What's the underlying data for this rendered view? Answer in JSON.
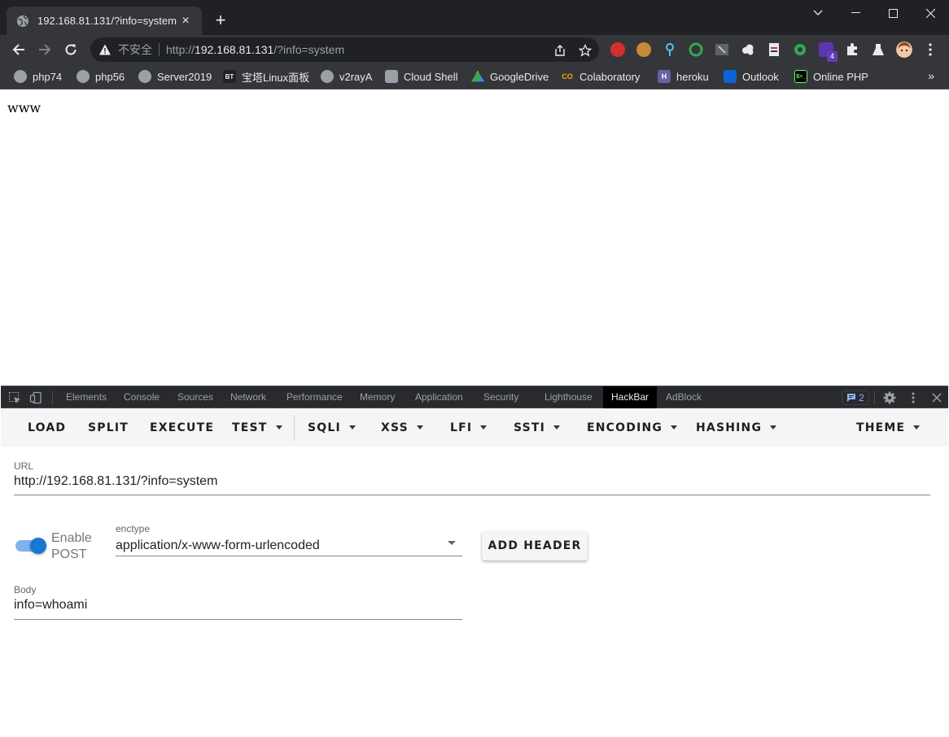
{
  "browser": {
    "tab_title": "192.168.81.131/?info=system",
    "tab_close": "×",
    "new_tab": "+",
    "security_label": "不安全",
    "url_scheme": "http://",
    "url_host": "192.168.81.131",
    "url_path": "/?info=system"
  },
  "bookmarks": [
    {
      "label": "php74",
      "icon": "globe-icon"
    },
    {
      "label": "php56",
      "icon": "globe-icon"
    },
    {
      "label": "Server2019",
      "icon": "globe-icon"
    },
    {
      "label": "宝塔Linux面板",
      "icon": "bt-icon",
      "icon_text": "BT"
    },
    {
      "label": "v2rayA",
      "icon": "globe-icon"
    },
    {
      "label": "Cloud Shell",
      "icon": "terminal-icon"
    },
    {
      "label": "GoogleDrive",
      "icon": "drive-icon"
    },
    {
      "label": "Colaboratory",
      "icon": "colab-icon",
      "icon_text": "CO"
    },
    {
      "label": "heroku",
      "icon": "heroku-icon",
      "icon_text": "H"
    },
    {
      "label": "Outlook",
      "icon": "outlook-icon"
    },
    {
      "label": "Online PHP",
      "icon": "php-shell-icon",
      "icon_text": "$>_"
    }
  ],
  "bookmarks_more": "»",
  "page": {
    "output": "www"
  },
  "devtools": {
    "tabs": [
      "Elements",
      "Console",
      "Sources",
      "Network",
      "Performance",
      "Memory",
      "Application",
      "Security",
      "Lighthouse",
      "HackBar",
      "AdBlock"
    ],
    "active_tab": "HackBar",
    "issues_count": "2"
  },
  "hackbar": {
    "menu": [
      {
        "label": "LOAD",
        "dropdown": false
      },
      {
        "label": "SPLIT",
        "dropdown": false
      },
      {
        "label": "EXECUTE",
        "dropdown": false
      },
      {
        "label": "TEST",
        "dropdown": true
      },
      {
        "label": "SQLI",
        "dropdown": true
      },
      {
        "label": "XSS",
        "dropdown": true
      },
      {
        "label": "LFI",
        "dropdown": true
      },
      {
        "label": "SSTI",
        "dropdown": true
      },
      {
        "label": "ENCODING",
        "dropdown": true
      },
      {
        "label": "HASHING",
        "dropdown": true
      },
      {
        "label": "THEME",
        "dropdown": true
      }
    ],
    "url_label": "URL",
    "url_value": "http://192.168.81.131/?info=system",
    "enable_post_line1": "Enable",
    "enable_post_line2": "POST",
    "enable_post_on": true,
    "enctype_label": "enctype",
    "enctype_value": "application/x-www-form-urlencoded",
    "add_header_label": "ADD HEADER",
    "body_label": "Body",
    "body_value": "info=whoami"
  },
  "colors": {
    "accent": "#1976d2",
    "chrome_dark": "#202124",
    "toolbar": "#35363a"
  }
}
